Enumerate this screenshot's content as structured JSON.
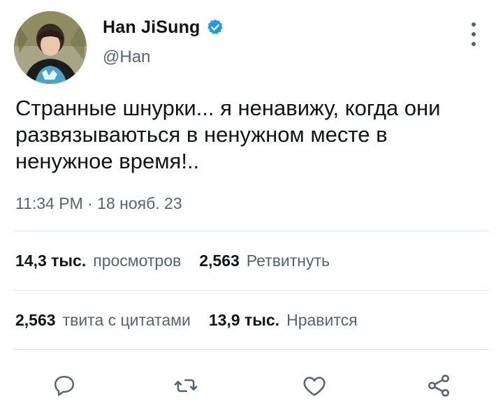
{
  "user": {
    "display_name": "Han JiSung",
    "handle": "@Han",
    "verified": true,
    "avatar": "profile-photo"
  },
  "tweet": {
    "text": "Странные шнурки... я ненавижу, когда они\nразвязываються в ненужном месте в\nненужное время!..",
    "timestamp": "11:34 PM · 18 нояб. 23"
  },
  "stats": {
    "views_count": "14,3 тыс.",
    "views_label": "просмотров",
    "retweets_count": "2,563",
    "retweets_label": "Ретвитнуть",
    "quotes_count": "2,563",
    "quotes_label": "твита с цитатами",
    "likes_count": "13,9 тыс.",
    "likes_label": "Нравится"
  },
  "actions": {
    "icons": [
      "reply-icon",
      "retweet-icon",
      "like-icon",
      "share-icon"
    ]
  },
  "colors": {
    "primary_text": "#0f1419",
    "secondary_text": "#536471",
    "verified_badge": "#1d9bf0",
    "divider": "#dfe4e8",
    "icon": "#536471"
  }
}
